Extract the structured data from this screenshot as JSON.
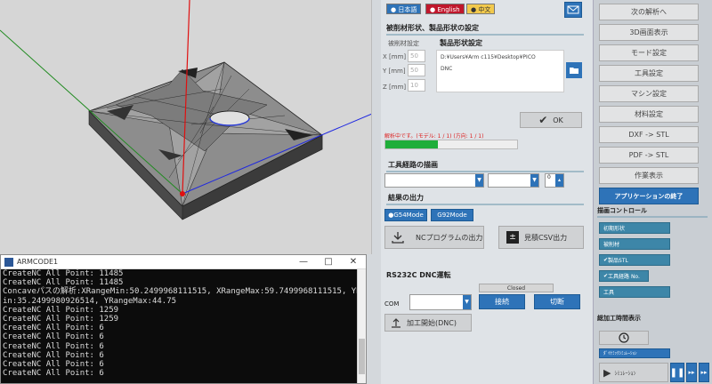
{
  "console": {
    "title": "ARMCODE1",
    "controls": [
      "—",
      "□",
      "✕"
    ],
    "lines": [
      "CreateNC All Point: 11485",
      "CreateNC All Point: 11485",
      "Concaveパスの解析:XRangeMin:50.2499968111515, XRangeMax:59.7499968111515, YRangeM",
      "in:35.2499980926514, YRangeMax:44.75",
      "CreateNC All Point: 1259",
      "CreateNC All Point: 1259",
      "CreateNC All Point: 6",
      "CreateNC All Point: 6",
      "CreateNC All Point: 6",
      "CreateNC All Point: 6",
      "CreateNC All Point: 6",
      "CreateNC All Point: 6"
    ]
  },
  "languages": [
    {
      "label": "日本語",
      "color": "#2e73b8",
      "text": "#ffffff"
    },
    {
      "label": "English",
      "color": "#c0172c",
      "text": "#ffffff"
    },
    {
      "label": "中文",
      "color": "#f2c94c",
      "text": "#333333"
    }
  ],
  "shape": {
    "title": "被削材形状、製品形状の設定",
    "work_label": "被削材設定",
    "product_label": "製品形状設定",
    "x_label": "X [mm]",
    "y_label": "Y [mm]",
    "z_label": "Z [mm]",
    "x_value": "50",
    "y_value": "50",
    "z_value": "10",
    "path_text": "D:¥Users¥Arm c115¥Desktop¥PICO",
    "path_text2": "DNC",
    "ok_label": "OK"
  },
  "progress": {
    "status": "解析中です。(モデル: 1 / 1) (方向: 1 / 1)",
    "value": 0.4
  },
  "toolpath": {
    "title": "工具経路の描画",
    "combo3_value": "0"
  },
  "output": {
    "title": "結果の出力",
    "g54": "G54Mode",
    "g92": "G92Mode",
    "nc_btn": "NCプログラムの出力",
    "csv_btn": "見積CSV出力"
  },
  "dnc": {
    "title": "RS232C DNC運転",
    "status": "Closed",
    "com_label": "COM",
    "connect": "接続",
    "disconnect": "切断",
    "start": "加工開始(DNC)"
  },
  "right": {
    "buttons": [
      "次の解析へ",
      "3D画面表示",
      "モード設定",
      "工具設定",
      "マシン設定",
      "材料設定",
      "DXF -> STL",
      "PDF -> STL",
      "作業表示"
    ],
    "quit": "アプリケーションの終了",
    "draw_title": "描画コントロール",
    "toggles": [
      "初期形状",
      "被削材",
      "製品STL",
      "工具経路 No.",
      "工具"
    ],
    "time_title": "総加工時間表示",
    "sim_label": "ｼﾐｭﾚｰｼｮﾝ",
    "sim_toggle": "ﾀﾞｲﾅﾐｯｸｼﾐｭﾚｰｼｮﾝ"
  }
}
